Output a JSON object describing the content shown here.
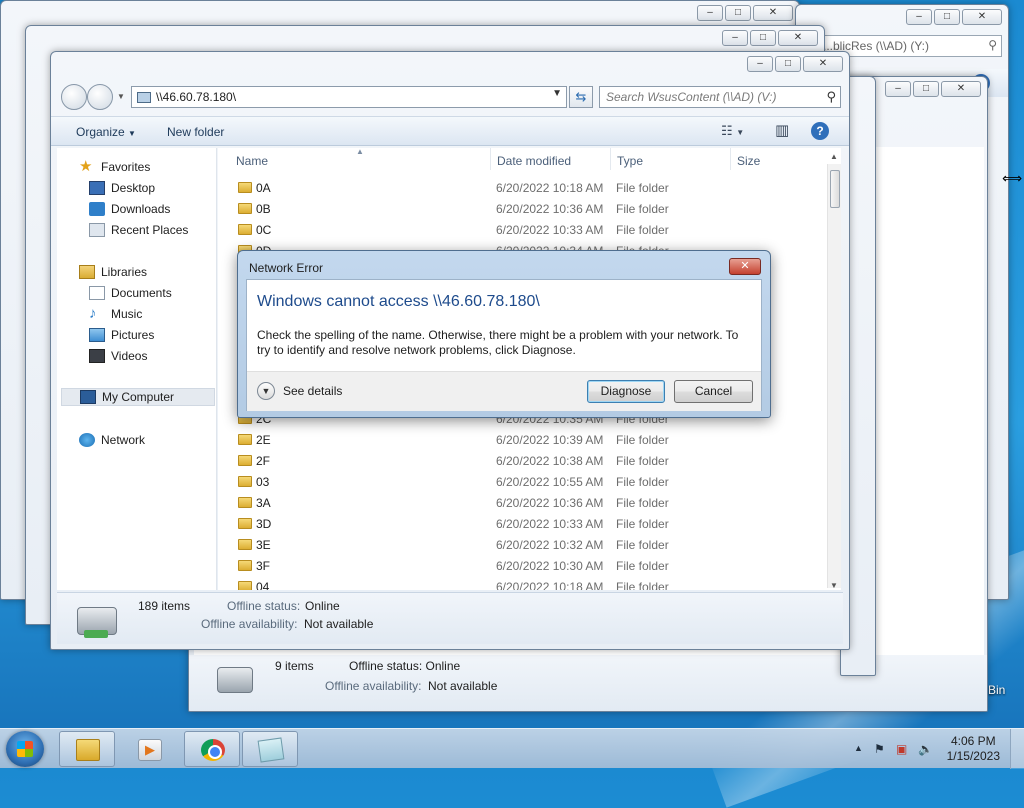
{
  "background_windows": {
    "back1_search": "...blicRes (\\\\AD) (Y:)",
    "back3_status_count": "9 items",
    "back3_status_offline": "Offline status: Online",
    "back3_availability_label": "Offline availability:",
    "back3_availability_value": "Not available"
  },
  "explorer": {
    "address": "\\\\46.60.78.180\\",
    "search_placeholder": "Search WsusContent (\\\\AD) (V:)",
    "toolbar": {
      "organize": "Organize",
      "new_folder": "New folder"
    },
    "nav": {
      "favorites": "Favorites",
      "desktop": "Desktop",
      "downloads": "Downloads",
      "recent_places": "Recent Places",
      "libraries": "Libraries",
      "documents": "Documents",
      "music": "Music",
      "pictures": "Pictures",
      "videos": "Videos",
      "my_computer": "My Computer",
      "network": "Network"
    },
    "columns": {
      "name": "Name",
      "date_modified": "Date modified",
      "type": "Type",
      "size": "Size"
    },
    "files": [
      {
        "name": "0A",
        "date": "6/20/2022 10:18 AM",
        "type": "File folder"
      },
      {
        "name": "0B",
        "date": "6/20/2022 10:36 AM",
        "type": "File folder"
      },
      {
        "name": "0C",
        "date": "6/20/2022 10:33 AM",
        "type": "File folder"
      },
      {
        "name": "0D",
        "date": "6/20/2022 10:34 AM",
        "type": "File folder"
      },
      {
        "name": "2C",
        "date": "6/20/2022 10:35 AM",
        "type": "File folder"
      },
      {
        "name": "2E",
        "date": "6/20/2022 10:39 AM",
        "type": "File folder"
      },
      {
        "name": "2F",
        "date": "6/20/2022 10:38 AM",
        "type": "File folder"
      },
      {
        "name": "03",
        "date": "6/20/2022 10:55 AM",
        "type": "File folder"
      },
      {
        "name": "3A",
        "date": "6/20/2022 10:36 AM",
        "type": "File folder"
      },
      {
        "name": "3D",
        "date": "6/20/2022 10:33 AM",
        "type": "File folder"
      },
      {
        "name": "3E",
        "date": "6/20/2022 10:32 AM",
        "type": "File folder"
      },
      {
        "name": "3F",
        "date": "6/20/2022 10:30 AM",
        "type": "File folder"
      },
      {
        "name": "04",
        "date": "6/20/2022 10:18 AM",
        "type": "File folder"
      }
    ],
    "details": {
      "item_count": "189 items",
      "offline_status_label": "Offline status:",
      "offline_status_value": "Online",
      "offline_availability_label": "Offline availability:",
      "offline_availability_value": "Not available"
    }
  },
  "dialog": {
    "title": "Network Error",
    "heading": "Windows cannot access \\\\46.60.78.180\\",
    "message": "Check the spelling of the name. Otherwise, there might be a problem with your network. To try to identify and resolve network problems, click Diagnose.",
    "see_details": "See details",
    "diagnose": "Diagnose",
    "cancel": "Cancel"
  },
  "desktop": {
    "recycle_bin_partial": "Bin"
  },
  "taskbar": {
    "time": "4:06 PM",
    "date": "1/15/2023",
    "apps": [
      "windows-explorer",
      "windows-media-player",
      "google-chrome",
      "sticky-notes"
    ]
  }
}
